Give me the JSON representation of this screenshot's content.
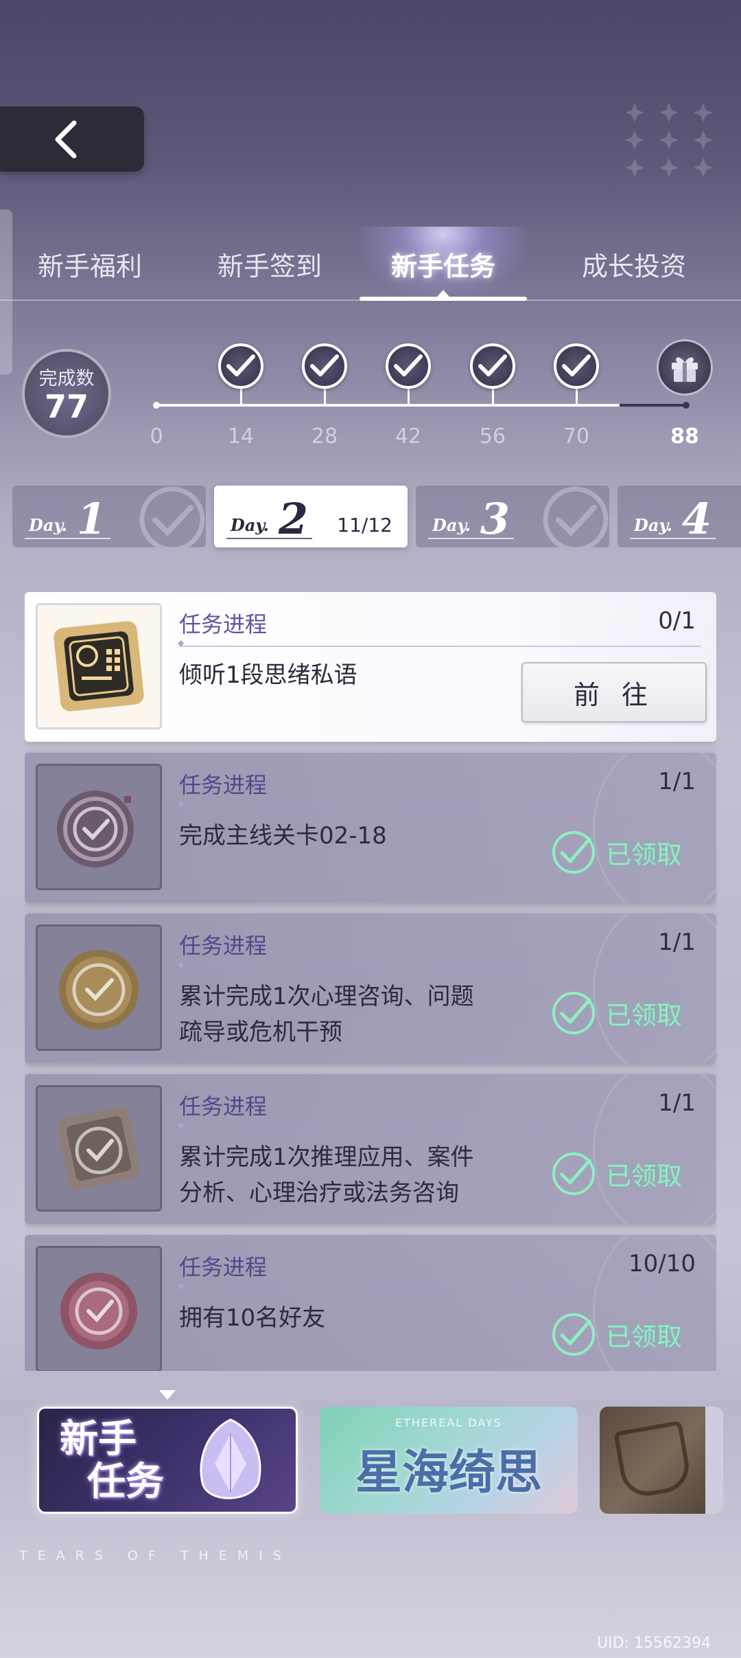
{
  "tabs": [
    {
      "label": "新手福利",
      "active": false
    },
    {
      "label": "新手签到",
      "active": false
    },
    {
      "label": "新手任务",
      "active": true
    },
    {
      "label": "成长投资",
      "active": false
    }
  ],
  "progress": {
    "label": "完成数",
    "value": "77",
    "milestones": [
      "0",
      "14",
      "28",
      "42",
      "56",
      "70",
      "88"
    ],
    "final_reward_icon": "gift-icon"
  },
  "days": [
    {
      "word": "Day.",
      "num": "1",
      "state": "completed"
    },
    {
      "word": "Day.",
      "num": "2",
      "state": "active",
      "progress": "11/12"
    },
    {
      "word": "Day.",
      "num": "3",
      "state": "completed"
    },
    {
      "word": "Day.",
      "num": "4",
      "state": "completed"
    }
  ],
  "tasks": [
    {
      "progress_label": "任务进程",
      "progress": "0/1",
      "desc": "倾听1段思绪私语",
      "status": "todo",
      "button": "前 往",
      "icon": "chip-card-icon"
    },
    {
      "progress_label": "任务进程",
      "progress": "1/1",
      "desc": "完成主线关卡02-18",
      "status": "done",
      "claimed": "已领取",
      "icon": "ring-token-icon"
    },
    {
      "progress_label": "任务进程",
      "progress": "1/1",
      "desc": "累计完成1次心理咨询、问题疏导或危机干预",
      "status": "done",
      "claimed": "已领取",
      "icon": "gold-coin-icon"
    },
    {
      "progress_label": "任务进程",
      "progress": "1/1",
      "desc": "累计完成1次推理应用、案件分析、心理治疗或法务咨询",
      "status": "done",
      "claimed": "已领取",
      "icon": "square-token-icon"
    },
    {
      "progress_label": "任务进程",
      "progress": "10/10",
      "desc": "拥有10名好友",
      "status": "done",
      "claimed": "已领取",
      "icon": "pink-badge-icon"
    }
  ],
  "banners": [
    {
      "line1": "新手",
      "line2": "任务",
      "selected": true
    },
    {
      "title": "星海绮思",
      "sub": "ETHEREAL DAYS",
      "selected": false
    },
    {
      "title": "",
      "selected": false
    }
  ],
  "footer": {
    "brand": "TEARS OF THEMIS",
    "uid": "UID: 15562394"
  },
  "colors": {
    "accent_claimed": "#8ef0c2",
    "progress_label": "#5a56a0",
    "button_bg": "#efeef3"
  }
}
